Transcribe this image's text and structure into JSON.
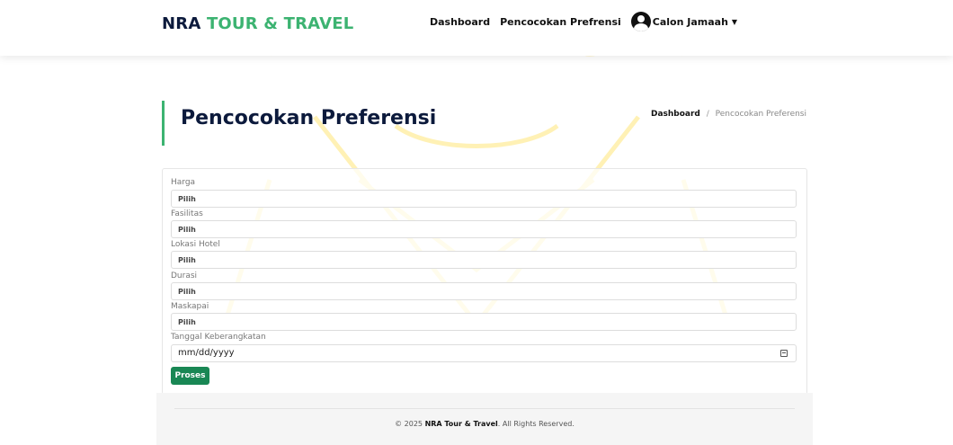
{
  "brand": {
    "part1": "NRA",
    "part2": "TOUR & TRAVEL"
  },
  "nav": {
    "dashboard": "Dashboard",
    "pencocokan": "Pencocokan Prefrensi",
    "user": "Calon Jamaah"
  },
  "page": {
    "title": "Pencocokan Preferensi",
    "breadcrumb_home": "Dashboard",
    "breadcrumb_sep": "/",
    "breadcrumb_current": "Pencocokan Preferensi"
  },
  "form": {
    "harga_label": "Harga",
    "harga_value": "Pilih",
    "fasilitas_label": "Fasilitas",
    "fasilitas_value": "Pilih",
    "lokasi_label": "Lokasi Hotel",
    "lokasi_value": "Pilih",
    "durasi_label": "Durasi",
    "durasi_value": "Pilih",
    "maskapai_label": "Maskapai",
    "maskapai_value": "Pilih",
    "tanggal_label": "Tanggal Keberangkatan",
    "tanggal_placeholder": "mm/dd/yyyy",
    "submit_label": "Proses"
  },
  "footer": {
    "prefix": "© 2025",
    "brand": "NRA Tour & Travel",
    "suffix": ". All Rights Reserved."
  },
  "watermark": {
    "text": "TMA PERSI"
  },
  "colors": {
    "accent_green": "#3cb371",
    "button_green": "#198754",
    "brand_navy": "#0c1a3c",
    "watermark_yellow": "#fff3b8"
  }
}
